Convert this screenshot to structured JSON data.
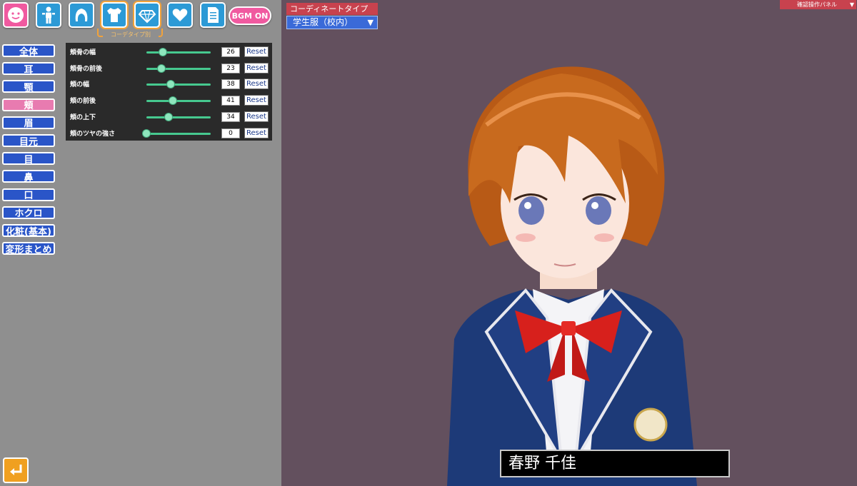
{
  "colors": {
    "viewport_bg": "#63505e",
    "panel_bg": "#8f8f8f",
    "category_blue": "#2a55c8",
    "category_pink": "#e87bb0",
    "slider_green": "#46c98f",
    "accent_red": "#c8424e",
    "accent_orange": "#f2a23a"
  },
  "toolbar": {
    "icons": [
      {
        "name": "face-icon",
        "style": "pink"
      },
      {
        "name": "body-icon",
        "style": "blue"
      },
      {
        "name": "hair-icon",
        "style": "blue"
      },
      {
        "name": "clothes-icon",
        "style": "blue"
      },
      {
        "name": "accessory-icon",
        "style": "blue"
      },
      {
        "name": "heart-icon",
        "style": "blue"
      },
      {
        "name": "document-icon",
        "style": "blue"
      }
    ],
    "coordinate_group_label": "コーデタイプ別",
    "bgm_label": "BGM ON"
  },
  "categories": [
    {
      "label": "全体",
      "active": false
    },
    {
      "label": "耳",
      "active": false
    },
    {
      "label": "顎",
      "active": false
    },
    {
      "label": "頬",
      "active": true
    },
    {
      "label": "眉",
      "active": false
    },
    {
      "label": "目元",
      "active": false
    },
    {
      "label": "目",
      "active": false
    },
    {
      "label": "鼻",
      "active": false
    },
    {
      "label": "口",
      "active": false
    },
    {
      "label": "ホクロ",
      "active": false
    },
    {
      "label": "化粧(基本)",
      "active": false
    },
    {
      "label": "変形まとめ",
      "active": false
    }
  ],
  "sliders": [
    {
      "label": "頬骨の幅",
      "value": "26",
      "level": 26,
      "reset": "Reset"
    },
    {
      "label": "頬骨の前後",
      "value": "23",
      "level": 23,
      "reset": "Reset"
    },
    {
      "label": "頬の幅",
      "value": "38",
      "level": 38,
      "reset": "Reset"
    },
    {
      "label": "頬の前後",
      "value": "41",
      "level": 41,
      "reset": "Reset"
    },
    {
      "label": "頬の上下",
      "value": "34",
      "level": 34,
      "reset": "Reset"
    },
    {
      "label": "頬のツヤの強さ",
      "value": "0",
      "level": 0,
      "reset": "Reset"
    }
  ],
  "coordinate": {
    "header": "コーディネートタイプ",
    "selected": "学生服（校内）",
    "arrow": "▼"
  },
  "confirm_panel": {
    "label": "確認操作パネル",
    "arrow": "▼"
  },
  "character": {
    "name": "春野 千佳"
  }
}
